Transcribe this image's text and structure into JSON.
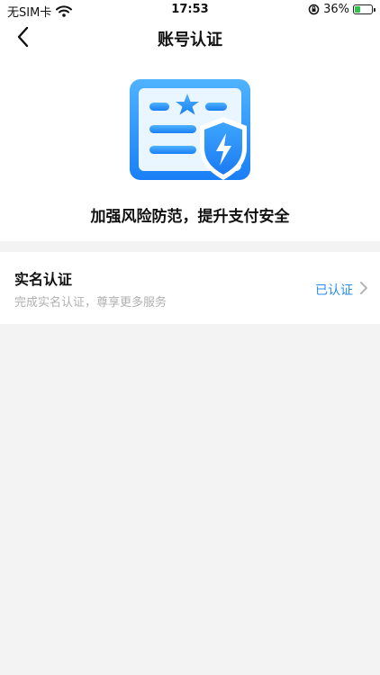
{
  "status_bar": {
    "carrier": "无SIM卡",
    "time": "17:53",
    "battery_text": "36%",
    "battery_level": 0.36
  },
  "nav": {
    "title": "账号认证",
    "back_icon": "chevron-left-icon"
  },
  "hero": {
    "icon": "id-card-shield-icon",
    "slogan": "加强风险防范，提升支付安全"
  },
  "verification_item": {
    "title": "实名认证",
    "subtitle": "完成实名认证，尊享更多服务",
    "status": "已认证",
    "status_color": "#2a8ef0"
  },
  "colors": {
    "accent": "#2a8ef0",
    "background": "#f3f3f3"
  }
}
